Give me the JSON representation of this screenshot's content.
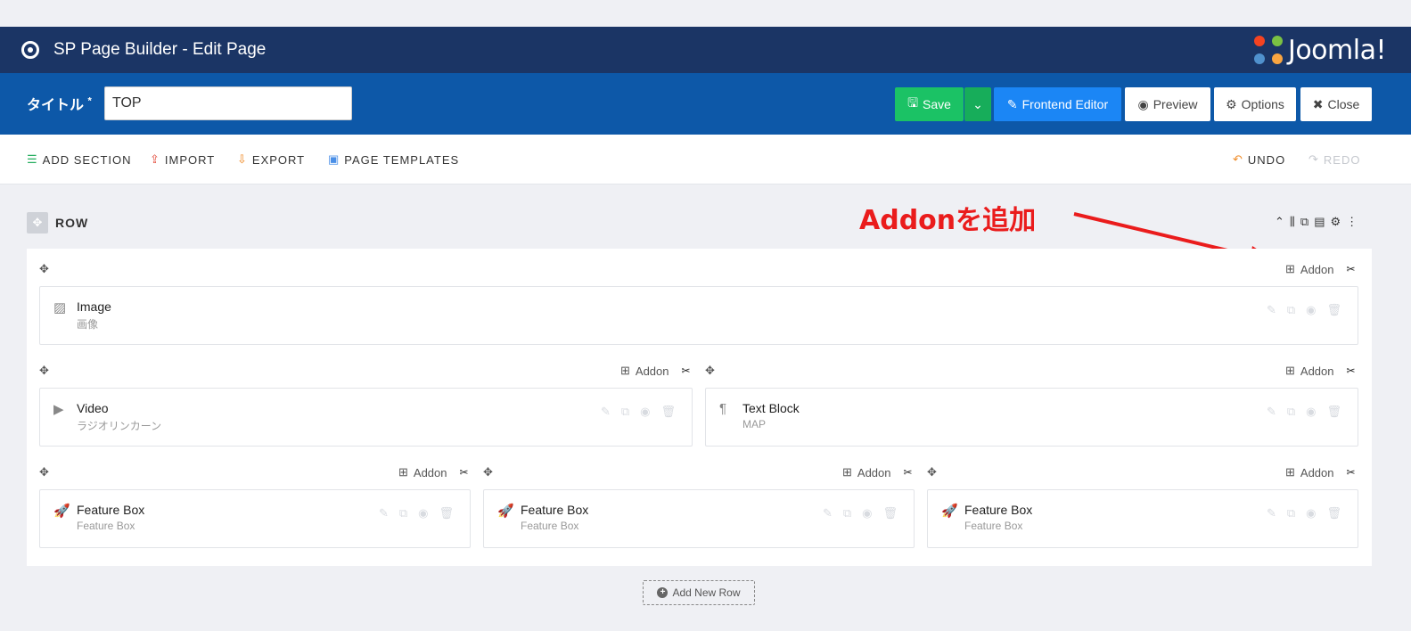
{
  "header": {
    "title": "SP Page Builder - Edit Page",
    "brand": "Joomla!"
  },
  "titlebar": {
    "label": "タイトル",
    "required_mark": "*",
    "value": "TOP",
    "buttons": {
      "save": "Save",
      "frontend": "Frontend Editor",
      "preview": "Preview",
      "options": "Options",
      "close": "Close"
    }
  },
  "toolbar": {
    "add_section": "ADD SECTION",
    "import": "IMPORT",
    "export": "EXPORT",
    "page_templates": "PAGE TEMPLATES",
    "undo": "UNDO",
    "redo": "REDO"
  },
  "row": {
    "label": "ROW"
  },
  "annotation": {
    "text": "Addonを追加",
    "color": "#ea1c1c"
  },
  "columns": {
    "addon_label": "Addon"
  },
  "addons": {
    "image": {
      "title": "Image",
      "subtitle": "画像"
    },
    "video": {
      "title": "Video",
      "subtitle": "ラジオリンカーン"
    },
    "text_block": {
      "title": "Text Block",
      "subtitle": "MAP"
    },
    "feature1": {
      "title": "Feature Box",
      "subtitle": "Feature Box"
    },
    "feature2": {
      "title": "Feature Box",
      "subtitle": "Feature Box"
    },
    "feature3": {
      "title": "Feature Box",
      "subtitle": "Feature Box"
    }
  },
  "add_new_row": "Add New Row",
  "colors": {
    "header": "#1b3565",
    "titlebar": "#0d58a8",
    "save": "#1bc265",
    "frontend": "#1b86f5"
  }
}
